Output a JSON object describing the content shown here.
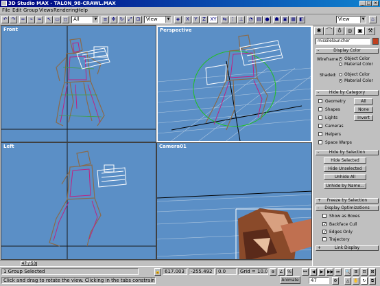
{
  "window": {
    "title": "3D Studio MAX - TALON_98-CRAWL.MAX"
  },
  "menu": [
    "File",
    "Edit",
    "Group",
    "Views",
    "Rendering",
    "Help"
  ],
  "toolbar": {
    "selection_filter": "All",
    "ref_coord_1": "View",
    "ref_coord_2": "View",
    "constraint_label": "XY"
  },
  "viewports": {
    "front": "Front",
    "perspective": "Perspective",
    "left": "Left",
    "camera": "Camera01"
  },
  "panel": {
    "object_name": "missilelauncher",
    "display_color": {
      "title": "Display Color",
      "wireframe_label": "Wireframe:",
      "shaded_label": "Shaded:",
      "object_color": "Object Color",
      "material_color": "Material Color"
    },
    "hide_by_category": {
      "title": "Hide by Category",
      "items": [
        "Geometry",
        "Shapes",
        "Lights",
        "Cameras",
        "Helpers",
        "Space Warps"
      ],
      "buttons": [
        "All",
        "None",
        "Invert"
      ]
    },
    "hide_by_selection": {
      "title": "Hide by Selection",
      "buttons": [
        "Hide Selected",
        "Hide Unselected",
        "Unhide All",
        "Unhide by Name..."
      ]
    },
    "freeze_by_selection": "Freeze by Selection",
    "display_optimizations": {
      "title": "Display Optimizations",
      "items": [
        {
          "label": "Show as Boxes",
          "checked": false
        },
        {
          "label": "Backface Cull",
          "checked": true
        },
        {
          "label": "Edges Only",
          "checked": true
        },
        {
          "label": "Trajectory",
          "checked": false
        }
      ]
    },
    "link_display": "Link Display"
  },
  "time": {
    "slider": "47 / 53",
    "frame": "47"
  },
  "status": {
    "selection": "1 Group Selected",
    "prompt": "Click and drag to rotate the view.  Clicking in the tabs constrains the rotation",
    "x": "617.003",
    "y": "-255.492",
    "z": "0.0",
    "grid": "Grid = 10.0",
    "animate": "Animate"
  }
}
